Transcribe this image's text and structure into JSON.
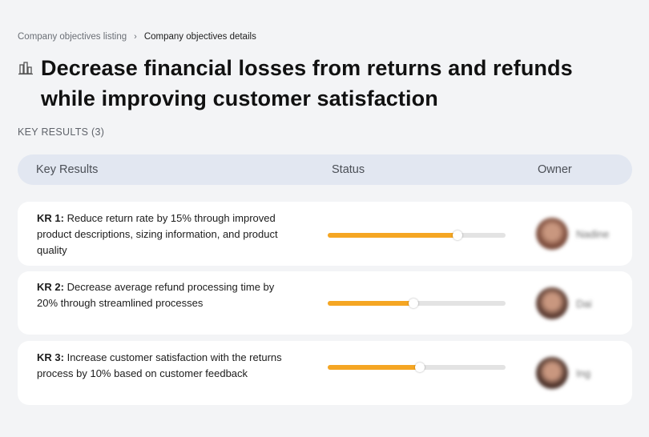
{
  "breadcrumb": {
    "parent": "Company objectives listing",
    "current": "Company objectives details"
  },
  "title_icon": "building-chart-icon",
  "title": "Decrease financial losses from returns and refunds while improving customer satisfaction",
  "key_results_label": "KEY RESULTS (3)",
  "table_header": {
    "key_results": "Key Results",
    "status": "Status",
    "owner": "Owner"
  },
  "colors": {
    "progress_fill": "#f5a623",
    "progress_track": "#e3e3e3",
    "header_bg": "#e2e7f1",
    "page_bg": "#f3f4f6"
  },
  "rows": [
    {
      "prefix": "KR 1:",
      "text": "Reduce return rate by 15% through improved product descriptions, sizing information, and product quality",
      "progress": 0.73,
      "owner": "Nadine",
      "avatar_color": "#7a4a3a"
    },
    {
      "prefix": "KR 2:",
      "text": "Decrease average refund processing time by 20% through streamlined processes",
      "progress": 0.48,
      "owner": "Dai",
      "avatar_color": "#5a3a30"
    },
    {
      "prefix": "KR 3:",
      "text": "Increase customer satisfaction with the returns process by 10% based on customer feedback",
      "progress": 0.52,
      "owner": "Ing",
      "avatar_color": "#4a3028"
    }
  ]
}
